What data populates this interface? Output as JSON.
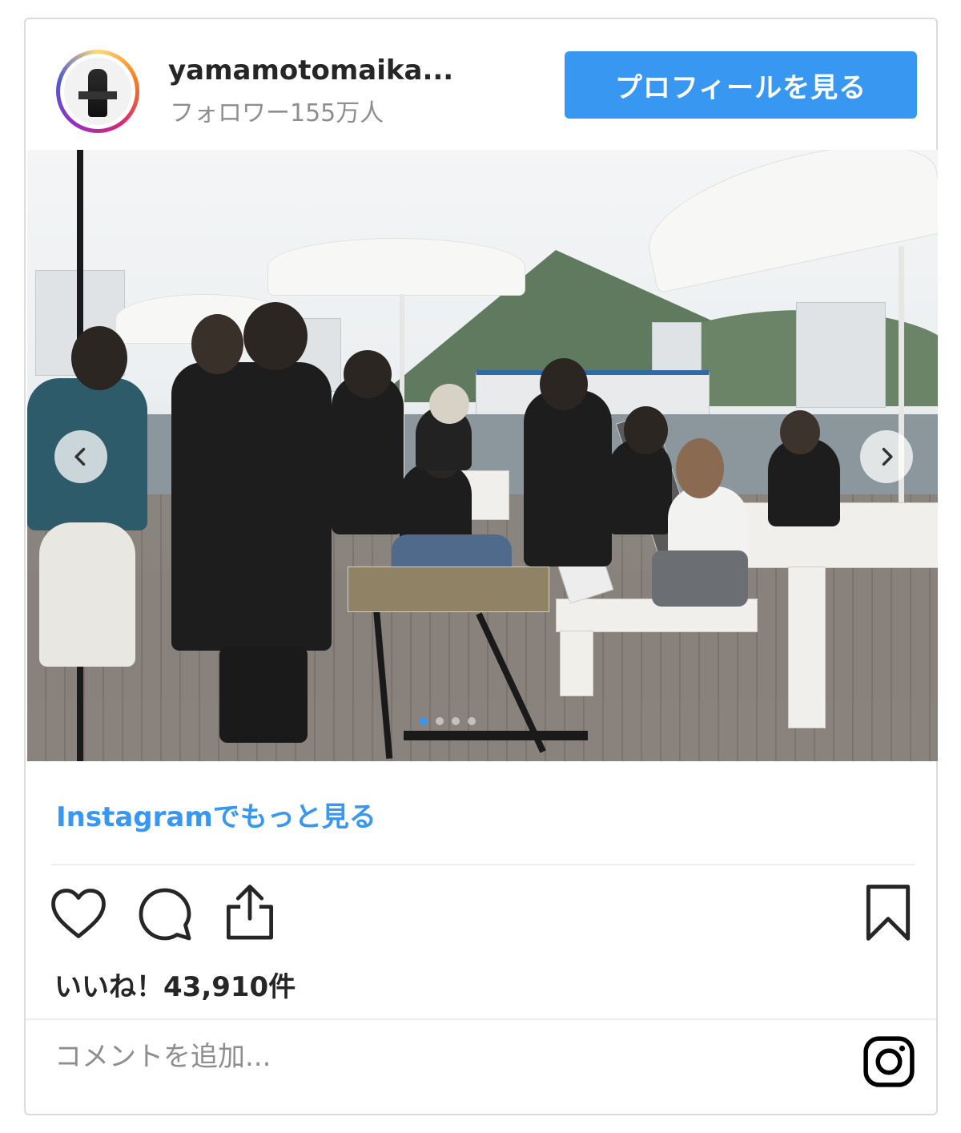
{
  "header": {
    "username": "yamamotomaika...",
    "followers": "フォロワー155万人",
    "profile_button": "プロフィールを見る"
  },
  "post": {
    "image_alt": "",
    "carousel": {
      "slide_count": 4,
      "active_index": 0
    }
  },
  "more_link": "Instagramでもっと見る",
  "actions": {
    "like_icon": "heart-icon",
    "comment_icon": "comment-icon",
    "share_icon": "share-icon",
    "save_icon": "bookmark-icon"
  },
  "likes_text": "いいね！43,910件",
  "comment": {
    "placeholder": "コメントを追加...",
    "value": ""
  },
  "colors": {
    "accent": "#3897f0",
    "text": "#262626",
    "muted": "#8e8e8e",
    "border": "#dbdbdb"
  }
}
